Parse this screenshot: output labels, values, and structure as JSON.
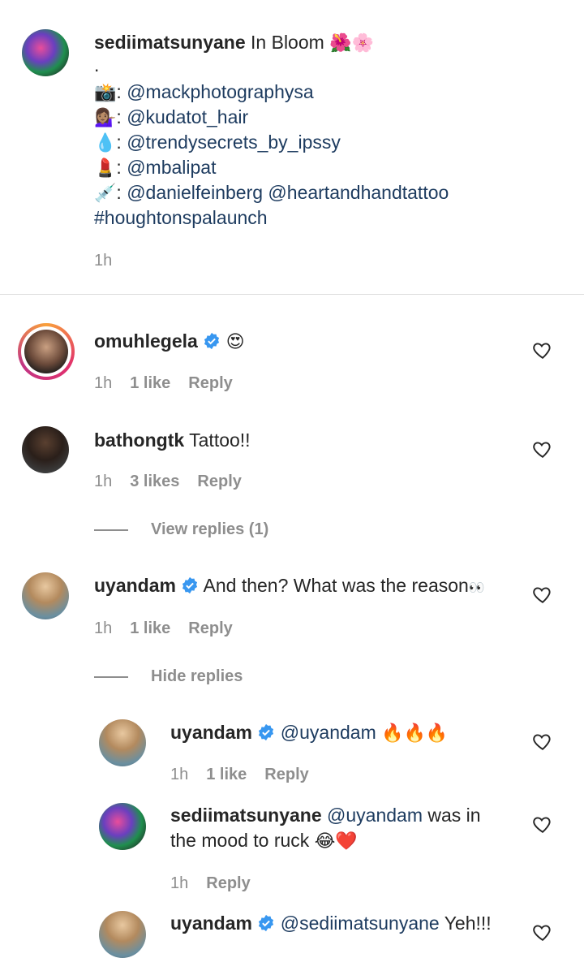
{
  "caption": {
    "username": "sediimatsunyane",
    "text": "In Bloom",
    "emoji": "🌺🌸",
    "dot": ".",
    "credits": [
      {
        "icon": "📸",
        "sep": ":",
        "handle": "@mackphotographysa"
      },
      {
        "icon": "💁🏽‍♀️",
        "sep": ":",
        "handle": "@kudatot_hair"
      },
      {
        "icon": "💧",
        "sep": ":",
        "handle": "@trendysecrets_by_ipssy"
      },
      {
        "icon": "💄",
        "sep": ":",
        "handle": "@mbalipat"
      },
      {
        "icon": "💉",
        "sep": ":",
        "handle": "@danielfeinberg @heartandhandtattoo"
      }
    ],
    "hashtag": "#houghtonspalaunch",
    "time": "1h"
  },
  "comments": [
    {
      "username": "omuhlegela",
      "verified": true,
      "text": "",
      "emoji": "😍",
      "time": "1h",
      "likes": "1 like",
      "reply": "Reply"
    },
    {
      "username": "bathongtk",
      "verified": false,
      "text": "Tattoo!!",
      "time": "1h",
      "likes": "3 likes",
      "reply": "Reply",
      "view_replies": "View replies (1)"
    },
    {
      "username": "uyandam",
      "verified": true,
      "text": "And then? What was the reason",
      "emoji": "👀",
      "time": "1h",
      "likes": "1 like",
      "reply": "Reply",
      "hide_replies": "Hide replies"
    }
  ],
  "replies": [
    {
      "username": "uyandam",
      "verified": true,
      "mention": "@uyandam",
      "text": "",
      "emoji": "🔥🔥🔥",
      "time": "1h",
      "likes": "1 like",
      "reply": "Reply"
    },
    {
      "username": "sediimatsunyane",
      "verified": false,
      "mention": "@uyandam",
      "text": "was in",
      "text2": "the mood to ruck",
      "emoji": "😂❤️",
      "time": "1h",
      "reply": "Reply"
    },
    {
      "username": "uyandam",
      "verified": true,
      "mention": "@sediimatsunyane",
      "text": "Yeh!!!"
    }
  ],
  "colors": {
    "link": "#1d3b5f",
    "verified": "#3897f0",
    "meta": "#8e8e8e"
  }
}
